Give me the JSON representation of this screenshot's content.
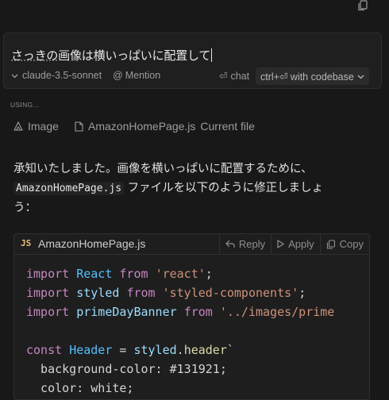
{
  "input": {
    "value_pre": "さっきの",
    "value_post": "画像は横いっぱいに配置して"
  },
  "footer": {
    "model": "claude-3.5-sonnet",
    "mention": "Mention",
    "chat": "chat",
    "codebase": "ctrl+⏎ with codebase"
  },
  "context": {
    "label": "USING...",
    "image": "Image",
    "file": "AmazonHomePage.js",
    "file_note": "Current file"
  },
  "message": {
    "line1": "承知いたしました。画像を横いっぱいに配置するために、",
    "code": "AmazonHomePage.js",
    "line2": "ファイルを以下のように修正しましょ",
    "line3": "う："
  },
  "code_block": {
    "lang": "JS",
    "filename": "AmazonHomePage.js",
    "reply": "Reply",
    "apply": "Apply",
    "copy": "Copy",
    "lines": [
      "import React from 'react';",
      "import styled from 'styled-components';",
      "import primeDayBanner from '../images/prime",
      "",
      "const Header = styled.header`",
      "  background-color: #131921;",
      "  color: white;"
    ]
  }
}
